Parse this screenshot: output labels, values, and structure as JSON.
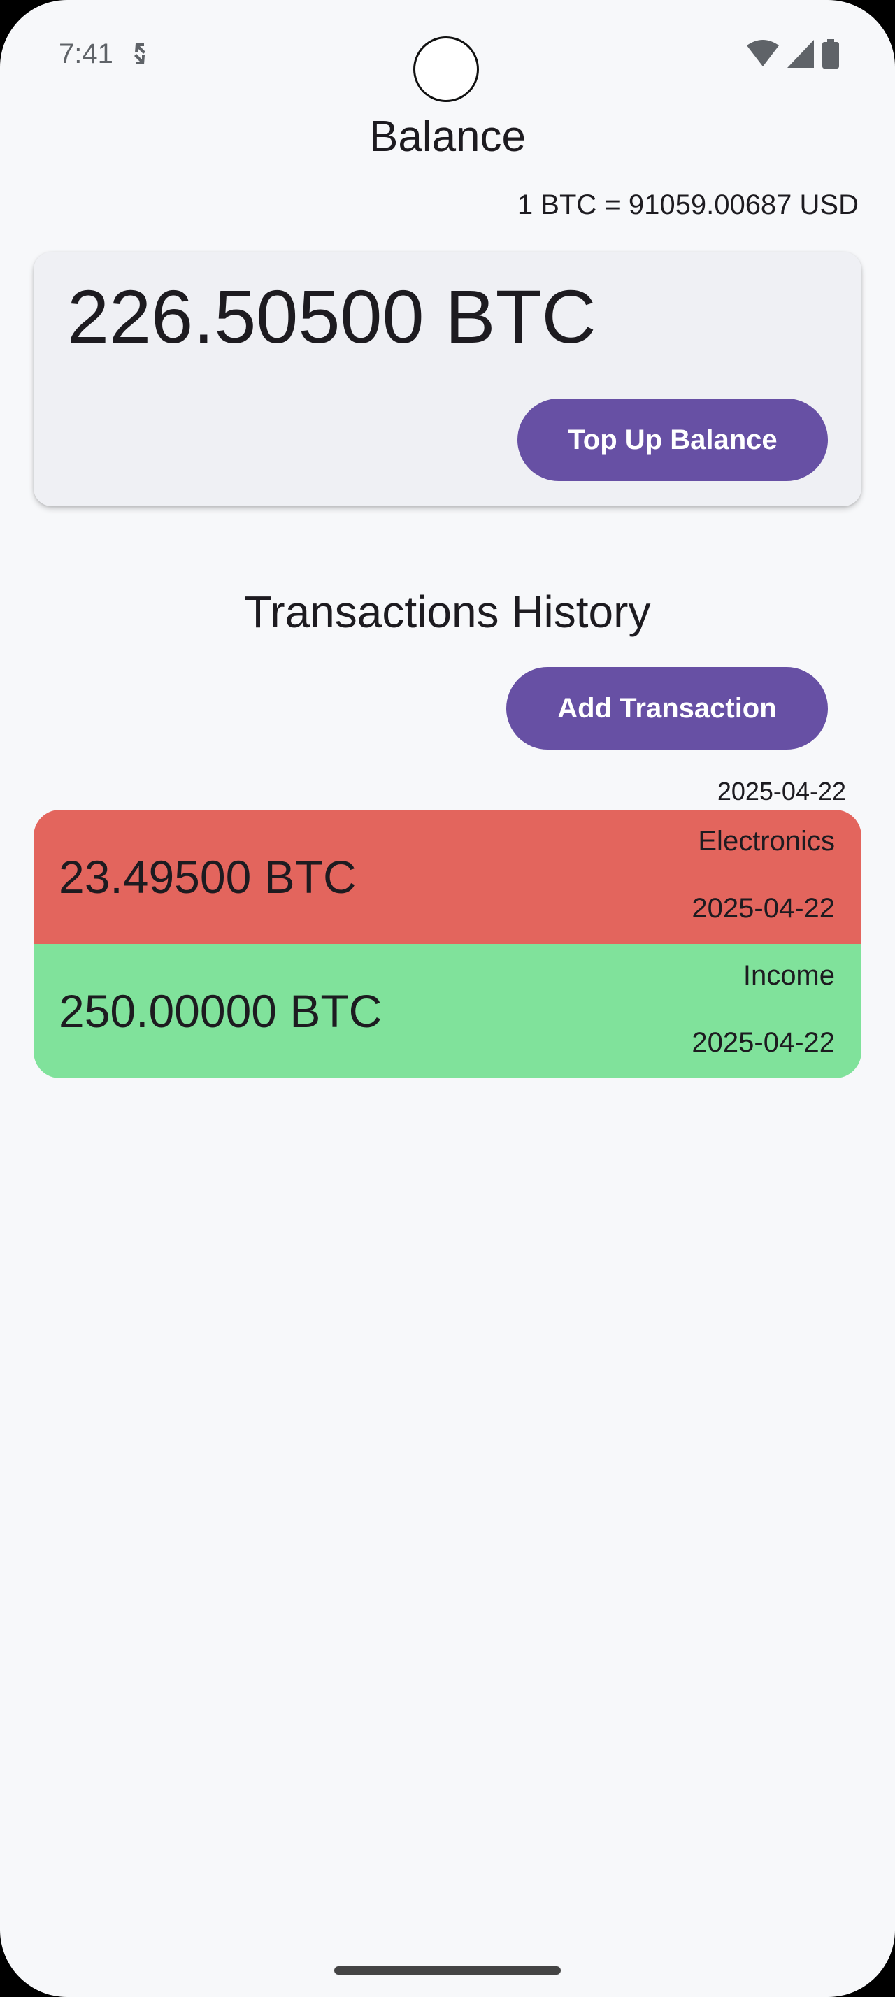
{
  "status_bar": {
    "time": "7:41",
    "icons": [
      "sync-icon",
      "wifi-icon",
      "signal-icon",
      "battery-icon"
    ]
  },
  "header": {
    "title": "Balance",
    "exchange_rate": "1 BTC = 91059.00687 USD"
  },
  "balance_card": {
    "amount": "226.50500 BTC",
    "top_up_label": "Top Up Balance"
  },
  "transactions": {
    "title": "Transactions History",
    "add_label": "Add Transaction",
    "group_date": "2025-04-22",
    "items": [
      {
        "amount": "23.49500 BTC",
        "category": "Electronics",
        "date": "2025-04-22",
        "color": "#e3655d"
      },
      {
        "amount": "250.00000 BTC",
        "category": "Income",
        "date": "2025-04-22",
        "color": "#80e29b"
      }
    ]
  },
  "colors": {
    "primary": "#6750a4",
    "background": "#f7f8fa",
    "expense": "#e3655d",
    "income": "#80e29b"
  }
}
